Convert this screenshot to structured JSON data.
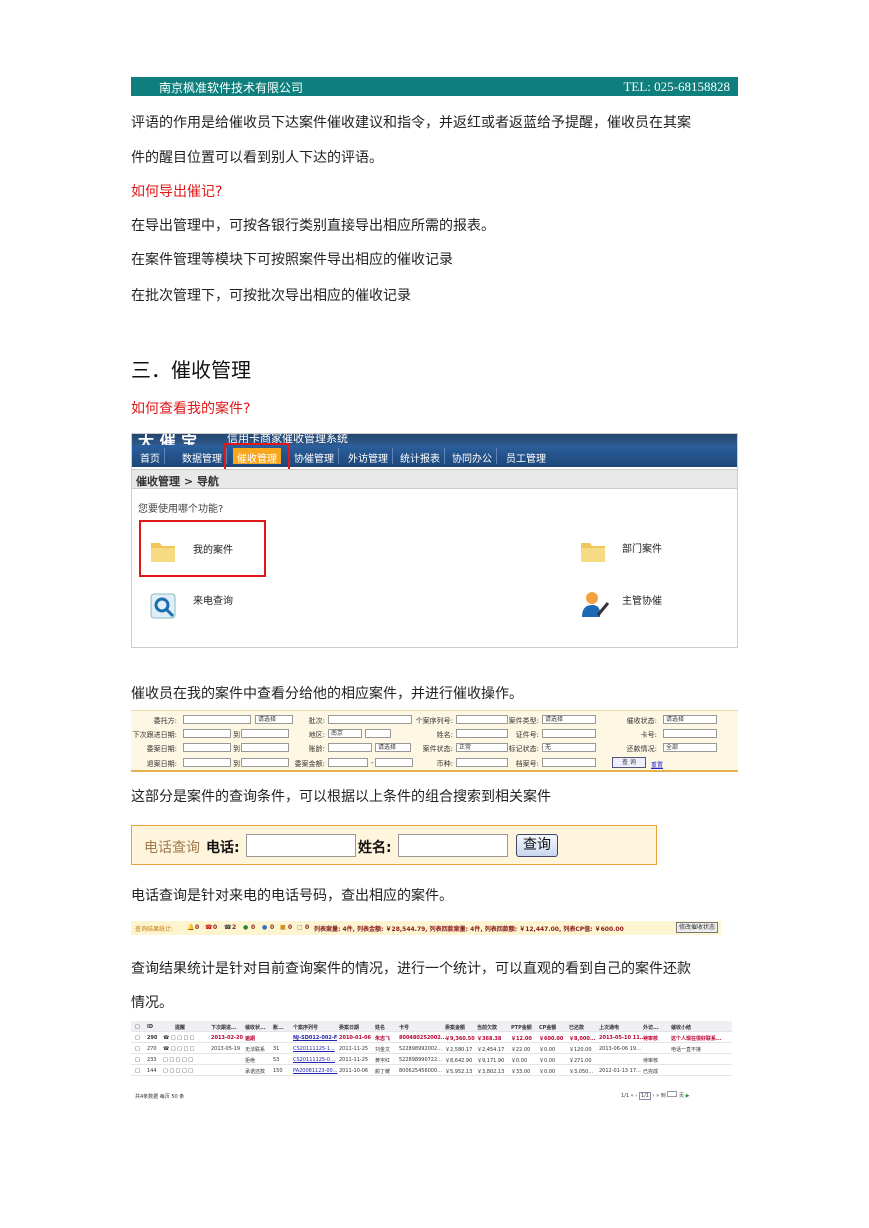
{
  "header": {
    "company": "南京枫准软件技术有限公司",
    "tel": "TEL: 025-68158828"
  },
  "paras": {
    "p1": "评语的作用是给催收员下达案件催收建议和指令，并返红或者返蓝给予提醒，催收员在其案",
    "p1b": "件的醒目位置可以看到别人下达的评语。",
    "q1": "如何导出催记?",
    "p2": "在导出管理中，可按各银行类别直接导出相应所需的报表。",
    "p3": "在案件管理等模块下可按照案件导出相应的催收记录",
    "p4": "在批次管理下，可按批次导出相应的催收记录",
    "section": "三．催收管理",
    "q2": "如何查看我的案件?",
    "p5": "催收员在我的案件中查看分给他的相应案件，并进行催收操作。",
    "p6": "这部分是案件的查询条件，可以根据以上条件的组合搜索到相关案件",
    "p7": "电话查询是针对来电的电话号码，查出相应的案件。",
    "p8": "查询结果统计是针对目前查询案件的情况，进行一个统计，可以直观的看到自己的案件还款",
    "p8b": "情况。"
  },
  "nav": {
    "logo": "大 催 宝",
    "banner": "信用卡商家催收管理系统",
    "menu": [
      "首页",
      "数据管理",
      "催收管理",
      "协催管理",
      "外访管理",
      "统计报表",
      "协同办公",
      "员工管理"
    ],
    "breadcrumb": "催收管理 > 导航",
    "question": "您要使用哪个功能?",
    "functions": [
      "我的案件",
      "部门案件",
      "来电查询",
      "主管协催"
    ]
  },
  "query_form": {
    "labels": [
      "委托方:",
      "批次:",
      "个案序列号:",
      "案件类型:",
      "催收状态:",
      "下次跟进日期:",
      "地区:",
      "姓名:",
      "证件号:",
      "卡号:",
      "委案日期:",
      "账龄:",
      "案件状态:",
      "标记状态:",
      "还款情况:",
      "退案日期:",
      "委案金额:",
      "币种:",
      "档案号:"
    ],
    "selects": [
      "请选择",
      "请选择",
      "请选择",
      "南京",
      "请选择",
      "正常",
      "无",
      "全部"
    ],
    "to": "到",
    "dash": "-",
    "search": "查 询",
    "reset": "重置"
  },
  "phone_query": {
    "title": "电话查询",
    "phone_label": "电话:",
    "name_label": "姓名:",
    "button": "查询"
  },
  "stats": {
    "label": "查询结果统计:",
    "counts": [
      "0",
      "0",
      "2",
      "0",
      "0",
      "0",
      "0"
    ],
    "summary": "列表案量: 4件, 列表金额: ￥28,544.79, 列表回款案量: 4件, 列表回款额: ￥12,447.00, 列表CP值: ￥600.00",
    "button": "修改催收状态"
  },
  "table": {
    "headers": [
      "ID",
      "提醒",
      "下次跟进...",
      "催收状...",
      "账...",
      "个案序列号",
      "委案日期",
      "姓名",
      "卡号",
      "委案金额",
      "当前欠款",
      "PTP金额",
      "CP金额",
      "已还款",
      "上次通电",
      "外访...",
      "催收小结"
    ],
    "rows": [
      [
        "290",
        "",
        "2013-02-20",
        "逾期",
        "",
        "NJ-SD012-002-F",
        "2010-01-06",
        "朱志飞",
        "800480252002...",
        "￥9,360.50",
        "￥368.38",
        "￥12.00",
        "￥600.00",
        "￥8,000...",
        "2013-05-10 11...",
        "待审核",
        "这个人现在很好联系..."
      ],
      [
        "270",
        "",
        "2013-05-19",
        "无法联系",
        "31",
        "CS20111125-1...",
        "2011-11-25",
        "刘金文",
        "522898992002...",
        "￥2,580.17",
        "￥2,454.17",
        "￥22.00",
        "￥0.00",
        "￥120.00",
        "2013-06-06 19...",
        "",
        "电话一直不接"
      ],
      [
        "233",
        "",
        "",
        "拒绝",
        "53",
        "CS20111125-0...",
        "2011-11-25",
        "黄宇红",
        "522898990722...",
        "￥8,642.90",
        "￥9,171.90",
        "￥0.00",
        "￥0.00",
        "￥271.00",
        "",
        "待审核",
        ""
      ],
      [
        "144",
        "",
        "",
        "承诺还款",
        "150",
        "PA20081123-00...",
        "2011-10-06",
        "颜丁耀",
        "800625456000...",
        "￥5,952.13",
        "￥3,802.13",
        "￥33.00",
        "￥0.00",
        "￥3,050...",
        "2012-01-13 17...",
        "已完成",
        ""
      ]
    ],
    "footer": "共4条数据 每页 50 条",
    "pager": "1/1",
    "goto": "到",
    "page_unit": "页"
  }
}
